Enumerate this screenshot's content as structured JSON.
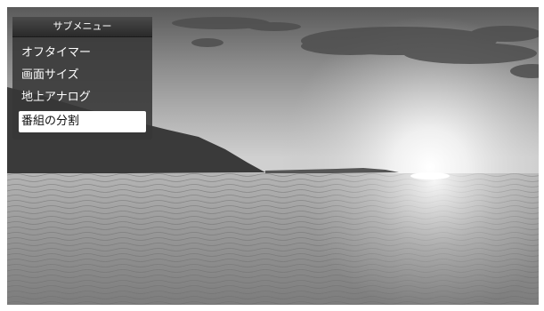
{
  "submenu": {
    "title": "サブメニュー",
    "items": [
      {
        "label": "オフタイマー",
        "selected": false
      },
      {
        "label": "画面サイズ",
        "selected": false
      },
      {
        "label": "地上アナログ",
        "selected": false
      },
      {
        "label": "番組の分割",
        "selected": true
      }
    ]
  },
  "scene": {
    "description_colors": {
      "sky": "#b8b8b8",
      "sea": "#9a9a9a",
      "sun": "#ffffff"
    }
  }
}
